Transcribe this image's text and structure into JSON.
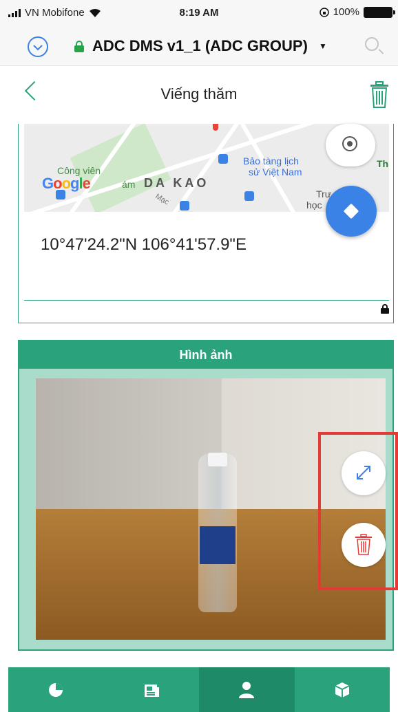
{
  "status_bar": {
    "carrier": "VN Mobifone",
    "time": "8:19 AM",
    "battery": "100%"
  },
  "header": {
    "app_title": "ADC DMS v1_1 (ADC GROUP)",
    "dropdown_caret": "▼"
  },
  "page": {
    "title": "Viếng thăm"
  },
  "map": {
    "labels": {
      "park": "Công viên",
      "park_suffix": "ám",
      "google": "Google",
      "district": "DA KAO",
      "museum_line1": "Bảo tàng lịch",
      "museum_line2": "sử Việt Nam",
      "school_partial": "Trư",
      "school_partial2": "học",
      "th_partial": "Th",
      "street_partial": "Mạc"
    },
    "coordinates": "10°47'24.2\"N 106°41'57.9\"E"
  },
  "image_section": {
    "title": "Hình ảnh"
  },
  "bottom_nav": {
    "items": [
      {
        "icon": "pie-chart-icon"
      },
      {
        "icon": "news-icon"
      },
      {
        "icon": "user-icon",
        "active": true
      },
      {
        "icon": "box-icon"
      }
    ]
  },
  "colors": {
    "accent": "#2aa37c",
    "accent_dark": "#1f8a67",
    "blue": "#3b82e6",
    "red": "#e53935"
  }
}
